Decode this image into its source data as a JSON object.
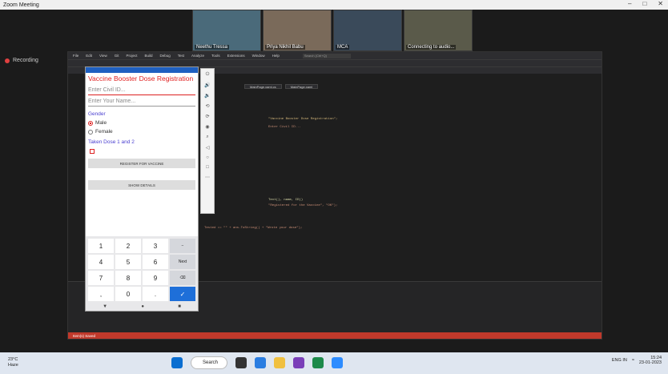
{
  "zoom": {
    "title": "Zoom Meeting",
    "recording_label": "Recording",
    "participants": [
      {
        "name": "Neethu Tressa",
        "bg": "#4a6a7a"
      },
      {
        "name": "Priya Nikhil Babu",
        "bg": "#7a6a5a"
      },
      {
        "name": "MCA",
        "bg": "#3a4a5a"
      },
      {
        "name": "Connecting to audio...",
        "bg": "#5a5a4a"
      }
    ]
  },
  "vs": {
    "menu": [
      "File",
      "Edit",
      "View",
      "Git",
      "Project",
      "Build",
      "Debug",
      "Test",
      "Analyze",
      "Tools",
      "Extensions",
      "Window",
      "Help"
    ],
    "search_placeholder": "Search (Ctrl+Q)",
    "tabs": [
      "MainPage.xaml.cs",
      "MainPage.xaml"
    ],
    "status": "Item(s) Saved",
    "code_lines": [
      "\"Vaccine Booster Dose Registration\";",
      "Enter Civil ID...",
      "Text(), name, ID()",
      "\"Registered for the Vaccine\", \"OK\");",
      "Tested == \"\" + ans.ToString() + \"Wrote your dose\");"
    ]
  },
  "app": {
    "title": "Vaccine Booster Dose Registration",
    "civil_id_placeholder": "Enter Civil ID...",
    "name_placeholder": "Enter Your Name...",
    "gender_label": "Gender",
    "male": "Male",
    "female": "Female",
    "dose_label": "Taken Dose 1 and 2",
    "register_button": "REGISTER FOR VACCINE",
    "show_button": "SHOW DETAILS",
    "keys": [
      "1",
      "2",
      "3",
      "−",
      "4",
      "5",
      "6",
      "Next",
      "7",
      "8",
      "9",
      "⌫",
      ",",
      "0",
      ".",
      "✓"
    ]
  },
  "taskbar": {
    "temp": "23°C",
    "weather": "Haze",
    "search": "Search",
    "lang": "ENG IN",
    "time": "15:24",
    "date": "23-01-2023"
  }
}
